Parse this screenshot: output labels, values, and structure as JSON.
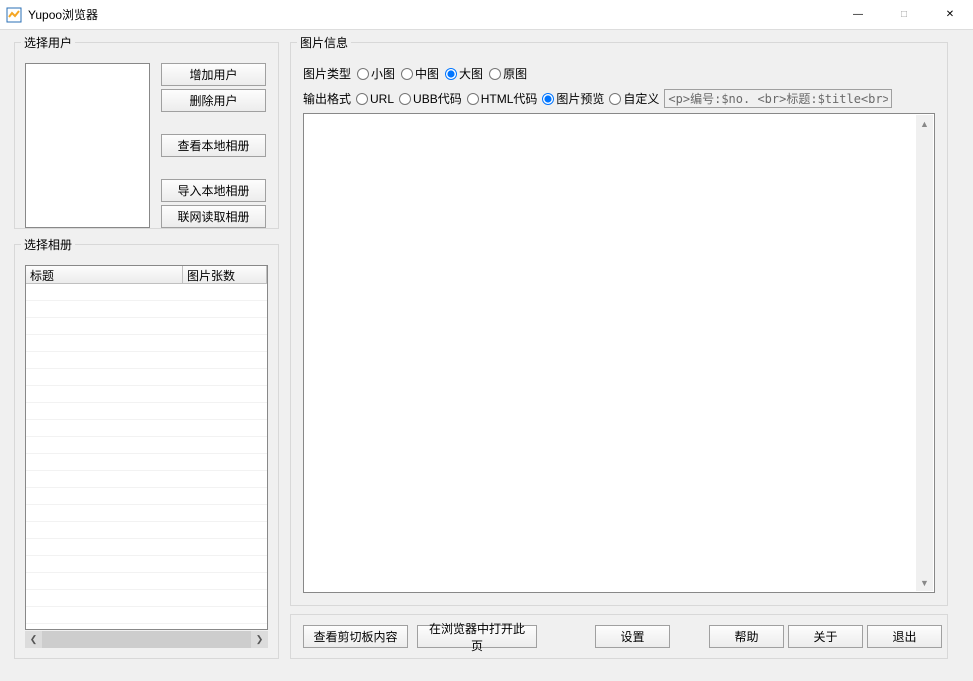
{
  "titlebar": {
    "title": "Yupoo浏览器"
  },
  "user_group": {
    "legend": "选择用户",
    "buttons": {
      "add": "增加用户",
      "del": "删除用户",
      "view_local": "查看本地相册",
      "import_local": "导入本地相册",
      "read_net": "联网读取相册"
    }
  },
  "album_group": {
    "legend": "选择相册",
    "col_title": "标题",
    "col_count": "图片张数"
  },
  "image_group": {
    "legend": "图片信息",
    "type_label": "图片类型",
    "type_options": {
      "small": "小图",
      "medium": "中图",
      "large": "大图",
      "orig": "原图"
    },
    "fmt_label": "输出格式",
    "fmt_options": {
      "url": "URL",
      "ubb": "UBB代码",
      "html": "HTML代码",
      "preview": "图片预览",
      "custom": "自定义"
    },
    "fmt_input": "<p>编号:$no. <br>标题:$title<br>描述:$descri"
  },
  "bottom": {
    "clip": "查看剪切板内容",
    "open": "在浏览器中打开此页",
    "settings": "设置",
    "help": "帮助",
    "about": "关于",
    "exit": "退出"
  }
}
